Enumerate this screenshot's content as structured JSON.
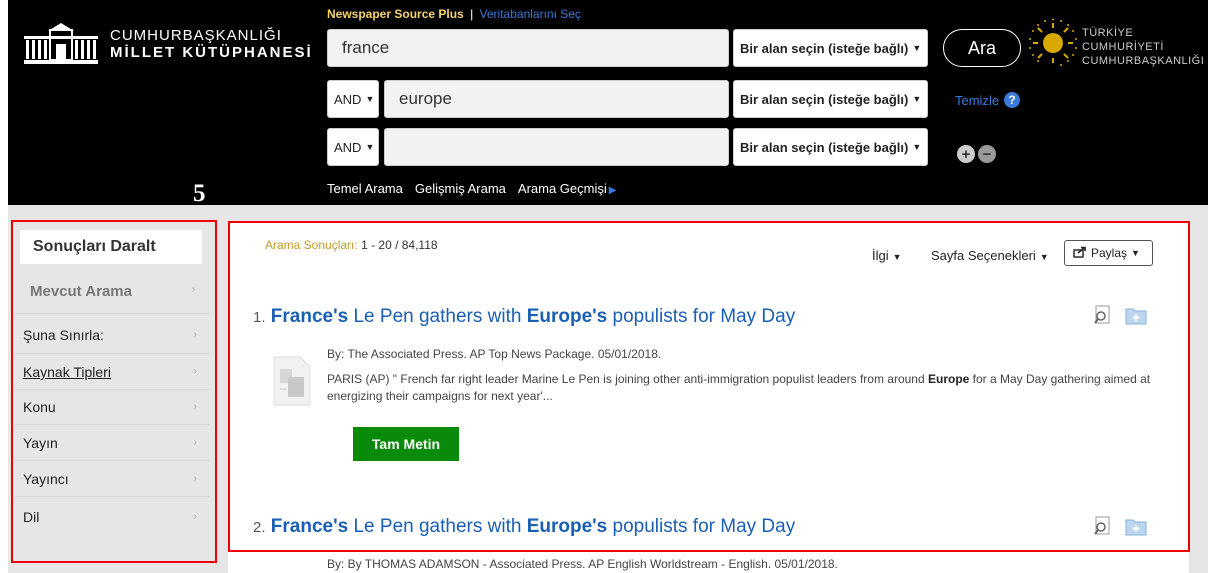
{
  "logo": {
    "line1": "CUMHURBAŞKANLIĞI",
    "line2": "MİLLET KÜTÜPHANESİ"
  },
  "database": {
    "name": "Newspaper Source Plus",
    "separator": "|",
    "change_label": "Veritabanlarını Seç"
  },
  "search": {
    "rows": [
      {
        "operator": "",
        "value": "france",
        "field": "Bir alan seçin (isteğe bağlı)"
      },
      {
        "operator": "AND",
        "value": "europe",
        "field": "Bir alan seçin (isteğe bağlı)"
      },
      {
        "operator": "AND",
        "value": "",
        "field": "Bir alan seçin (isteğe bağlı)"
      }
    ],
    "submit_label": "Ara",
    "clear_label": "Temizle",
    "help_glyph": "?",
    "add_glyph": "+",
    "remove_glyph": "−"
  },
  "government": {
    "line1": "TÜRKİYE CUMHURİYETİ",
    "line2": "CUMHURBAŞKANLIĞI"
  },
  "nav": {
    "basic": "Temel Arama",
    "advanced": "Gelişmiş Arama",
    "history": "Arama Geçmişi"
  },
  "step_label": "5",
  "sidebar": {
    "title": "Sonuçları Daralt",
    "current_search": "Mevcut Arama",
    "items": [
      "Şuna Sınırla:",
      "Kaynak Tipleri",
      "Konu",
      "Yayın",
      "Yayıncı",
      "Dil"
    ]
  },
  "results": {
    "count_label": "Arama Sonuçları:",
    "count_value": "1 - 20 / 84,118",
    "sort_label": "İlgi",
    "page_options_label": "Sayfa Seçenekleri",
    "share_label": "Paylaş",
    "items": [
      {
        "number": "1.",
        "title_part1": "France's",
        "title_part2": " Le Pen gathers with ",
        "title_part3": "Europe's",
        "title_part4": " populists for May Day",
        "meta": "By: The Associated Press. AP Top News Package. 05/01/2018.",
        "abstract_part1": "PARIS (AP) \" French far right leader Marine Le Pen is joining other anti-immigration populist leaders from around ",
        "abstract_bold": "Europe",
        "abstract_part2": " for a May Day gathering aimed at energizing their campaigns for next year'...",
        "fulltext_label": "Tam Metin"
      },
      {
        "number": "2.",
        "title_part1": "France's",
        "title_part2": " Le Pen gathers with ",
        "title_part3": "Europe's",
        "title_part4": " populists for May Day",
        "meta": "By: By THOMAS ADAMSON - Associated Press. AP English Worldstream - English. 05/01/2018."
      }
    ]
  },
  "colors": {
    "accent_blue": "#1a5fb4",
    "fulltext_green": "#0a8a0a",
    "highlight_red": "#e00000",
    "db_gold": "#f5d26b"
  }
}
